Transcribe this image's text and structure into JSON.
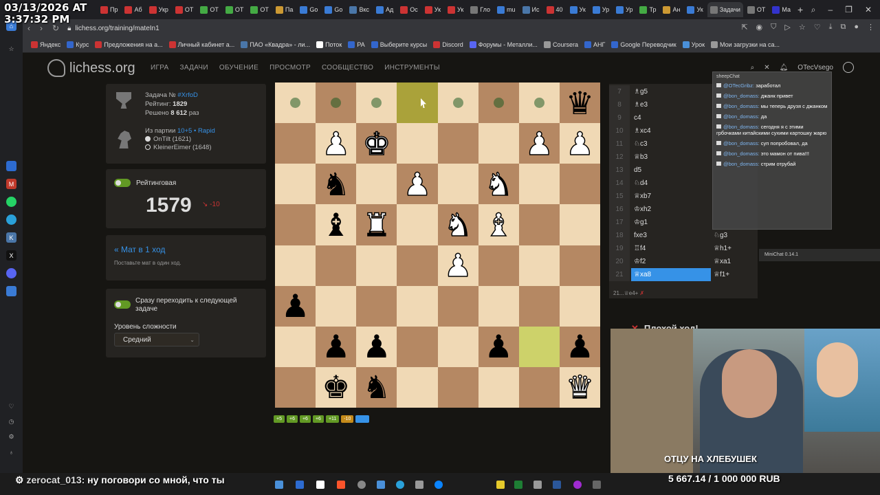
{
  "overlay": {
    "date": "03/13/2026 AT",
    "time": "3:37:32 PM"
  },
  "browser": {
    "tabs": [
      "Пр",
      "Аб",
      "Укр",
      "ОТ",
      "ОТ",
      "ОТ",
      "ОТ",
      "Па",
      "Go",
      "Go",
      "Вкс",
      "Ад",
      "Ос",
      "Ук",
      "Ук",
      "Гло",
      "mu",
      "Ис",
      "40",
      "Ук",
      "Ур",
      "Ур",
      "Тр",
      "Ан",
      "Ук",
      "Задачи",
      "ОТ",
      "Ма"
    ],
    "url": "lichess.org/training/mateIn1",
    "bookmarks": [
      "Яндекс",
      "Курс",
      "Предложения на а...",
      "Личный кабинет а...",
      "ПАО «Квадра» - ли...",
      "Поток",
      "РА",
      "Выберите курсы",
      "Discord",
      "Форумы - Металли...",
      "Coursera",
      "АНГ",
      "Google Переводчик",
      "Урок",
      "Мои загрузки на са..."
    ]
  },
  "header": {
    "logo": "lichess.org",
    "nav": [
      "ИГРА",
      "ЗАДАЧИ",
      "ОБУЧЕНИЕ",
      "ПРОСМОТР",
      "СООБЩЕСТВО",
      "ИНСТРУМЕНТЫ"
    ],
    "username": "OTecVsego"
  },
  "puzzle": {
    "task_label": "Задача №",
    "task_id": "#XrfoD",
    "rating_label": "Рейтинг:",
    "rating": "1829",
    "solved_label": "Решено",
    "solved_count": "8 612",
    "solved_suffix": "раз",
    "from_game": "Из партии",
    "game_link": "10+5 • Rapid",
    "player_white": "OnTilt (1621)",
    "player_black": "KleinerEimer (1648)"
  },
  "rated": {
    "label": "Рейтинговая",
    "value": "1579",
    "diff": "-10"
  },
  "theme": {
    "title": "« Мат в 1 ход",
    "subtitle": "Поставьте мат в один ход."
  },
  "settings": {
    "auto_next_label": "Сразу переходить к следующей задаче",
    "difficulty_label": "Уровень сложности",
    "difficulty_value": "Средний"
  },
  "history": [
    "+5",
    "+6",
    "+6",
    "+6",
    "+11",
    "-10"
  ],
  "moves": [
    {
      "n": "7",
      "w": "♗g5",
      "b": ""
    },
    {
      "n": "8",
      "w": "♗e3",
      "b": ""
    },
    {
      "n": "9",
      "w": "c4",
      "b": ""
    },
    {
      "n": "10",
      "w": "♗xc4",
      "b": ""
    },
    {
      "n": "11",
      "w": "♘c3",
      "b": ""
    },
    {
      "n": "12",
      "w": "♕b3",
      "b": ""
    },
    {
      "n": "13",
      "w": "d5",
      "b": ""
    },
    {
      "n": "14",
      "w": "♘d4",
      "b": ""
    },
    {
      "n": "15",
      "w": "♕xb7",
      "b": ""
    },
    {
      "n": "16",
      "w": "♔xh2",
      "b": ""
    },
    {
      "n": "17",
      "w": "♔g1",
      "b": ""
    },
    {
      "n": "18",
      "w": "fxe3",
      "b": "♘g3"
    },
    {
      "n": "19",
      "w": "♖f4",
      "b": "♕h1+"
    },
    {
      "n": "20",
      "w": "♔f2",
      "b": "♕xa1"
    },
    {
      "n": "21",
      "w": "♕xa8",
      "b": "♕f1+"
    }
  ],
  "last_move": "21...♕e4+",
  "bad_move": "Плохой ход!",
  "chat": {
    "title": "sheepChat",
    "messages": [
      {
        "user": "@OTecGribz:",
        "text": "заработал"
      },
      {
        "user": "@bon_domass:",
        "text": "джанк привет"
      },
      {
        "user": "@bon_domass:",
        "text": "мы теперь друзя с джанком"
      },
      {
        "user": "@bon_domass:",
        "text": "да"
      },
      {
        "user": "@bon_domass:",
        "text": "сегодня я с этими грбочками китайскими сухими картошку жарю"
      },
      {
        "user": "@bon_domass:",
        "text": "суп попробовал, да"
      },
      {
        "user": "@bon_domass:",
        "text": "это мамон от пива!!!"
      },
      {
        "user": "@bon_domass:",
        "text": "стрим отрубай"
      }
    ]
  },
  "minichat": "MiniChat 0.14.1",
  "webcam": {
    "caption": "ОТЦУ НА ХЛЕБУШЕК",
    "money": "5 667.14 / 1 000 000 RUB"
  },
  "stream_chat": {
    "user": "zerocat_013:",
    "text": "ну поговори со мной, что ты"
  },
  "board": {
    "orientation": "black",
    "squares": [
      [
        "mv",
        "mv",
        "mv",
        "hl-d",
        "mv",
        "mv",
        "mv",
        "bQ"
      ],
      [
        "",
        "wP",
        "wK",
        "",
        "",
        "",
        "wP",
        "wP"
      ],
      [
        "",
        "bN",
        "",
        "wP",
        "",
        "wN",
        "",
        ""
      ],
      [
        "",
        "bB",
        "wR",
        "",
        "wN",
        "wB",
        "",
        ""
      ],
      [
        "",
        "",
        "",
        "",
        "wP",
        "",
        "",
        ""
      ],
      [
        "bP",
        "",
        "",
        "",
        "",
        "",
        "",
        ""
      ],
      [
        "",
        "bP",
        "bP",
        "",
        "",
        "bP",
        "hl-l",
        "bP"
      ],
      [
        "",
        "bK",
        "bN",
        "",
        "",
        "",
        "",
        "wQ"
      ]
    ]
  }
}
